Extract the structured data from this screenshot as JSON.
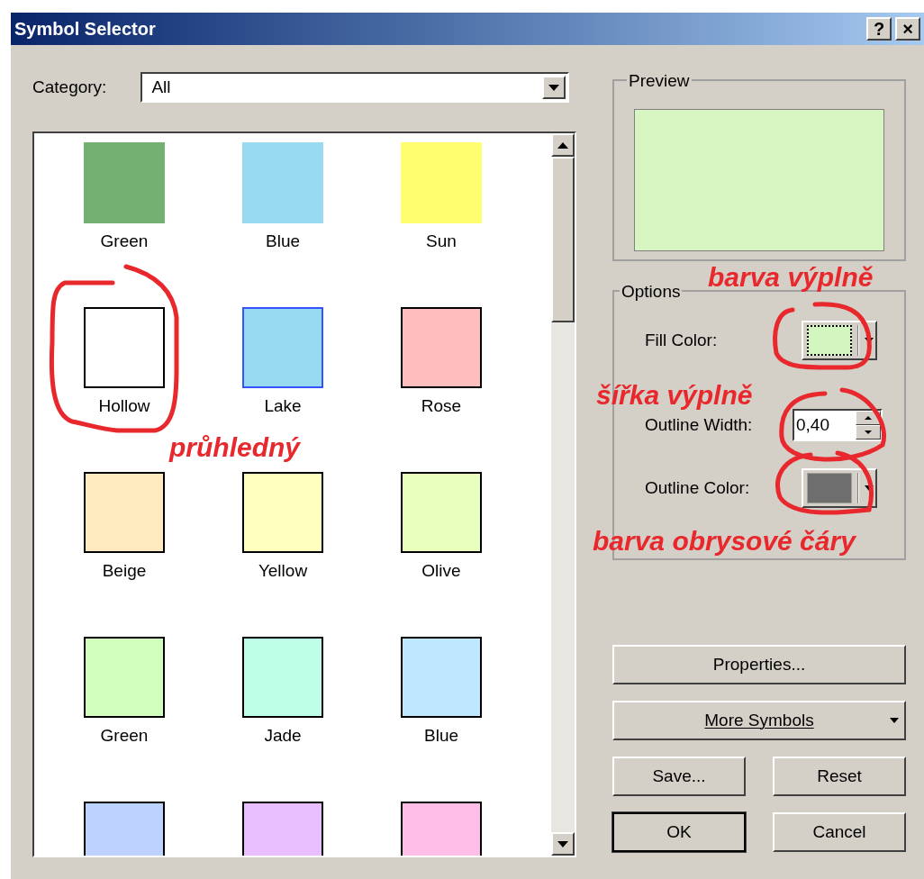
{
  "window": {
    "title": "Symbol Selector",
    "controls": [
      "?",
      "×"
    ]
  },
  "category": {
    "label": "Category:",
    "value": "All"
  },
  "symbols": [
    {
      "label": "Green",
      "color": "#74b072",
      "kind": "plain"
    },
    {
      "label": "Blue",
      "color": "#98daf0",
      "kind": "plain"
    },
    {
      "label": "Sun",
      "color": "#ffff70",
      "kind": "plain"
    },
    {
      "label": "Hollow",
      "color": "#ffffff",
      "kind": "outlined"
    },
    {
      "label": "Lake",
      "color": "#98daf0",
      "kind": "accent"
    },
    {
      "label": "Rose",
      "color": "#ffbebe",
      "kind": "outlined"
    },
    {
      "label": "Beige",
      "color": "#ffe9bf",
      "kind": "outlined"
    },
    {
      "label": "Yellow",
      "color": "#ffffbe",
      "kind": "outlined"
    },
    {
      "label": "Olive",
      "color": "#e9ffbe",
      "kind": "outlined"
    },
    {
      "label": "Green",
      "color": "#d3ffbe",
      "kind": "outlined"
    },
    {
      "label": "Jade",
      "color": "#beffe8",
      "kind": "outlined"
    },
    {
      "label": "Blue",
      "color": "#bee8ff",
      "kind": "outlined"
    },
    {
      "color": "#bed2ff",
      "kind": "outlined"
    },
    {
      "color": "#e8beff",
      "kind": "outlined"
    },
    {
      "color": "#ffbee8",
      "kind": "outlined"
    }
  ],
  "preview": {
    "title": "Preview",
    "color": "#d6f5c0"
  },
  "options": {
    "title": "Options",
    "fill": {
      "label": "Fill Color:",
      "color": "#d3f5c0"
    },
    "outline_width": {
      "label": "Outline Width:",
      "value": "0,40"
    },
    "outline": {
      "label": "Outline Color:",
      "color": "#6e6e6e"
    }
  },
  "buttons": [
    {
      "label": "Properties...",
      "kind": "wide"
    },
    {
      "label": "More Symbols",
      "kind": "menu"
    },
    {
      "label": "Save...",
      "kind": "small"
    },
    {
      "label": "Reset",
      "kind": "small"
    },
    {
      "label": "OK",
      "kind": "default"
    },
    {
      "label": "Cancel",
      "kind": "small"
    }
  ],
  "annotations": [
    "barva výplně",
    "šířka výplně",
    "barva obrysové čáry",
    "průhledný"
  ]
}
